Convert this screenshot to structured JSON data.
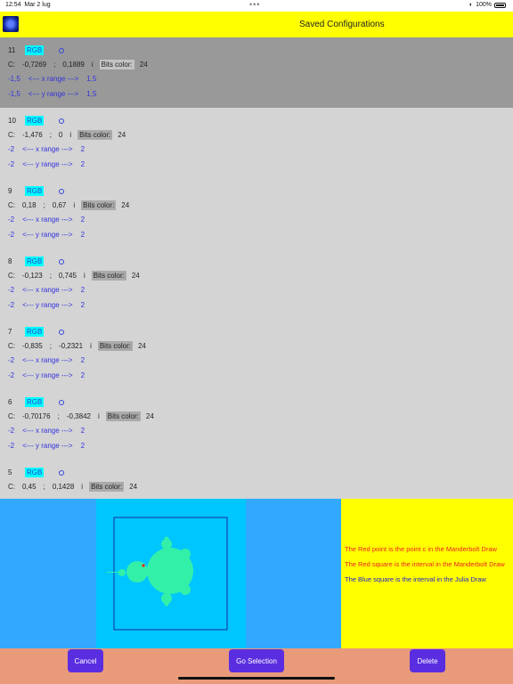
{
  "status_bar": {
    "time": "12:54",
    "date": "Mar 2 lug",
    "dots": "•••",
    "battery": "100%",
    "icons": [
      "wifi-icon",
      "battery-icon"
    ]
  },
  "header": {
    "title": "Saved Configurations",
    "icon": "mandelbrot-app-icon"
  },
  "configs": [
    {
      "num": "11",
      "rgb": "RGB",
      "c": "C:",
      "re": "-0,7269",
      "sep": ";",
      "im": "0,1889",
      "i": "i",
      "bits_label": "Bits color:",
      "bits": "24",
      "x_min": "-1,5",
      "x_label": "<--- x range --->",
      "x_max": "1,5",
      "y_min": "-1,5",
      "y_label": "<--- y range --->",
      "y_max": "1,5"
    },
    {
      "num": "10",
      "rgb": "RGB",
      "c": "C:",
      "re": "-1,476",
      "sep": ";",
      "im": "0",
      "i": "i",
      "bits_label": "Bits color:",
      "bits": "24",
      "x_min": "-2",
      "x_label": "<--- x range --->",
      "x_max": "2",
      "y_min": "-2",
      "y_label": "<--- y range --->",
      "y_max": "2"
    },
    {
      "num": "9",
      "rgb": "RGB",
      "c": "C:",
      "re": "0,18",
      "sep": ";",
      "im": "0,67",
      "i": "i",
      "bits_label": "Bits color:",
      "bits": "24",
      "x_min": "-2",
      "x_label": "<--- x range --->",
      "x_max": "2",
      "y_min": "-2",
      "y_label": "<--- y range --->",
      "y_max": "2"
    },
    {
      "num": "8",
      "rgb": "RGB",
      "c": "C:",
      "re": "-0,123",
      "sep": ";",
      "im": "0,745",
      "i": "i",
      "bits_label": "Bits color:",
      "bits": "24",
      "x_min": "-2",
      "x_label": "<--- x range --->",
      "x_max": "2",
      "y_min": "-2",
      "y_label": "<--- y range --->",
      "y_max": "2"
    },
    {
      "num": "7",
      "rgb": "RGB",
      "c": "C:",
      "re": "-0,835",
      "sep": ";",
      "im": "-0,2321",
      "i": "i",
      "bits_label": "Bits color:",
      "bits": "24",
      "x_min": "-2",
      "x_label": "<--- x range --->",
      "x_max": "2",
      "y_min": "-2",
      "y_label": "<--- y range --->",
      "y_max": "2"
    },
    {
      "num": "6",
      "rgb": "RGB",
      "c": "C:",
      "re": "-0,70176",
      "sep": ";",
      "im": "-0,3842",
      "i": "i",
      "bits_label": "Bits color:",
      "bits": "24",
      "x_min": "-2",
      "x_label": "<--- x range --->",
      "x_max": "2",
      "y_min": "-2",
      "y_label": "<--- y range --->",
      "y_max": "2"
    },
    {
      "num": "5",
      "rgb": "RGB",
      "c": "C:",
      "re": "0,45",
      "sep": ";",
      "im": "0,1428",
      "i": "i",
      "bits_label": "Bits color:",
      "bits": "24"
    }
  ],
  "info": {
    "red_point": "The Red point is the point c in the Manderbolt Draw",
    "red_square": "The Red square is the interval in the Manderbolt Draw",
    "blue_square": "The Blue square is the interval in the Julia Draw"
  },
  "buttons": {
    "cancel": "Cancel",
    "go": "Go Selection",
    "delete": "Delete"
  },
  "colors": {
    "header": "#ffff00",
    "selected_row": "#999999",
    "list_bg": "#d4d4d4",
    "rgb_badge": "#00ffff",
    "button": "#5a2ee0",
    "footer": "#e99a7a",
    "preview_bg": "#33a8ff",
    "canvas_bg": "#00c6ff",
    "mandelbrot_fill": "#33f0a8"
  }
}
